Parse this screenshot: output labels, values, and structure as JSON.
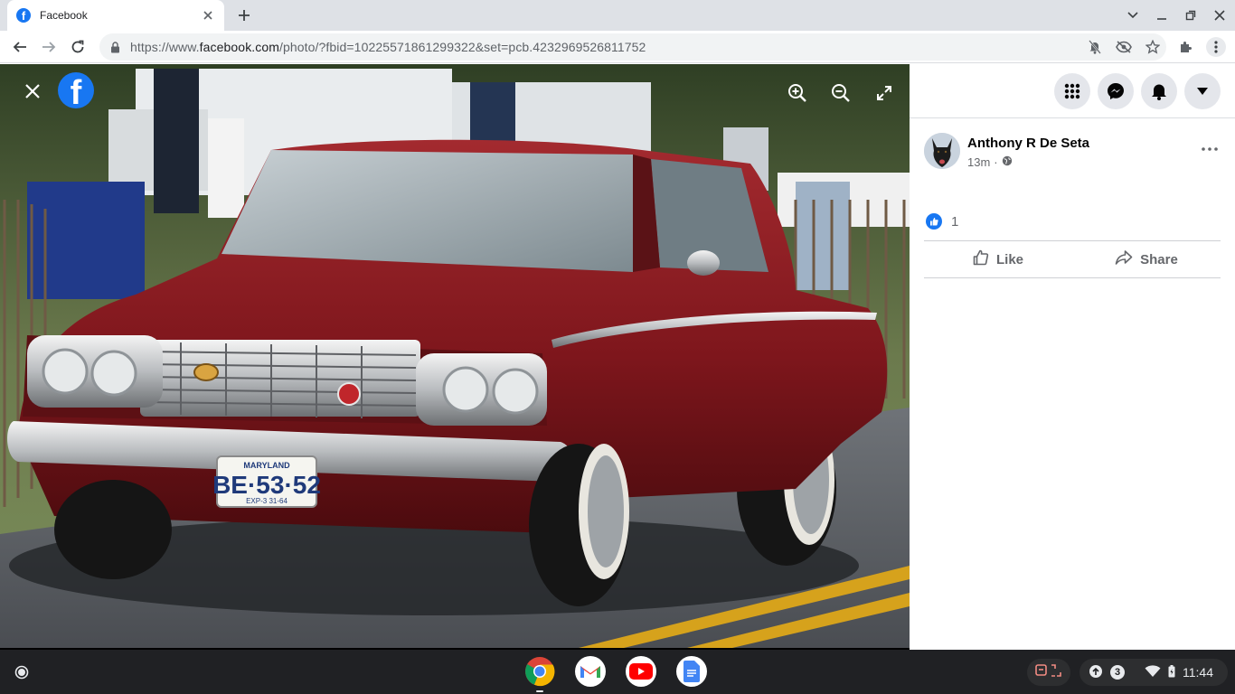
{
  "browser": {
    "tab_title": "Facebook",
    "url_prefix": "https://www.",
    "url_host": "facebook.com",
    "url_path": "/photo/?fbid=10225571861299322&set=pcb.4232969526811752"
  },
  "viewer": {
    "license_plate": {
      "state": "MARYLAND",
      "number": "BE·53·52",
      "exp": "EXP-3 31-64"
    }
  },
  "post": {
    "author": "Anthony R De Seta",
    "time": "13m",
    "reaction_count": "1",
    "actions": {
      "like": "Like",
      "share": "Share"
    }
  },
  "shelf": {
    "notification_count": "3",
    "clock": "11:44"
  },
  "colors": {
    "facebook_blue": "#1877f2",
    "car_red": "#8b1a1f"
  }
}
